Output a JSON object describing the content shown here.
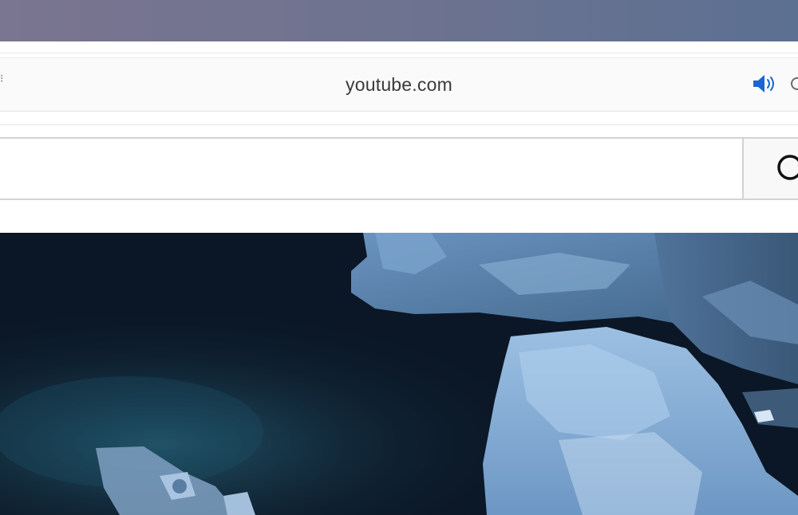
{
  "browser": {
    "address": {
      "url": "youtube.com"
    },
    "tab_audio": {
      "icon": "speaker-playing-icon",
      "color": "#1a64d6"
    },
    "reload": {
      "icon": "reload-icon"
    }
  },
  "page": {
    "search": {
      "value": "",
      "placeholder": "",
      "button_icon": "search-icon"
    },
    "video": {
      "description": "",
      "colors": {
        "water_dark": "#0b1726",
        "ice_light": "#8fb4d8",
        "ice_mid": "#5d87b3"
      }
    }
  }
}
